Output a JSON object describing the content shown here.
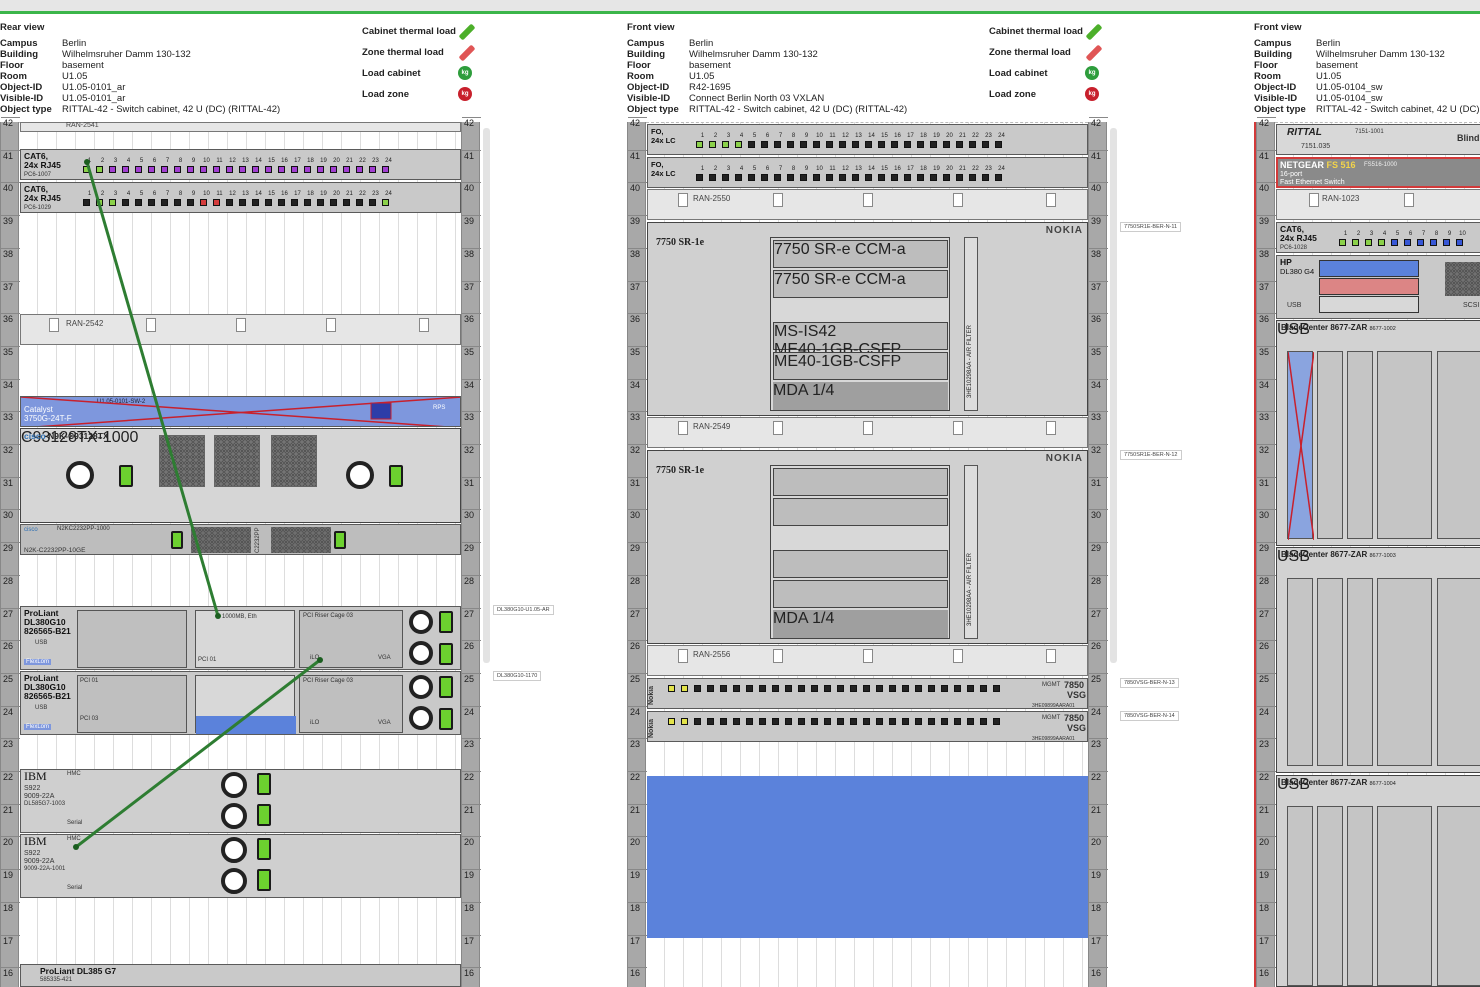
{
  "views": [
    {
      "view_title": "Rear view",
      "fields": [
        [
          "Campus",
          "Berlin"
        ],
        [
          "Building",
          "Wilhelmsruher Damm 130-132"
        ],
        [
          "Floor",
          "basement"
        ],
        [
          "Room",
          "U1.05"
        ],
        [
          "Object-ID",
          "U1.05-0101_ar"
        ],
        [
          "Visible-ID",
          "U1.05-0101_ar"
        ],
        [
          "Object type",
          "RITTAL-42 - Switch cabinet, 42 U (DC) (RITTAL-42)"
        ]
      ],
      "actions": [
        "Cabinet thermal load",
        "Zone thermal load",
        "Load cabinet",
        "Load zone"
      ]
    },
    {
      "view_title": "Front view",
      "fields": [
        [
          "Campus",
          "Berlin"
        ],
        [
          "Building",
          "Wilhelmsruher Damm 130-132"
        ],
        [
          "Floor",
          "basement"
        ],
        [
          "Room",
          "U1.05"
        ],
        [
          "Object-ID",
          "R42-1695"
        ],
        [
          "Visible-ID",
          "Connect Berlin North 03 VXLAN"
        ],
        [
          "Object type",
          "RITTAL-42 - Switch cabinet, 42 U (DC) (RITTAL-42)"
        ]
      ],
      "actions": [
        "Cabinet thermal load",
        "Zone thermal load",
        "Load cabinet",
        "Load zone"
      ]
    },
    {
      "view_title": "Front view",
      "fields": [
        [
          "Campus",
          "Berlin"
        ],
        [
          "Building",
          "Wilhelmsruher Damm 130-132"
        ],
        [
          "Floor",
          "basement"
        ],
        [
          "Room",
          "U1.05"
        ],
        [
          "Object-ID",
          "U1.05-0104_sw"
        ],
        [
          "Visible-ID",
          "U1.05-0104_sw"
        ],
        [
          "Object type",
          "RITTAL-42 - Switch cabinet, 42 U (DC)"
        ]
      ],
      "actions": []
    }
  ],
  "colors": {
    "accent_green": "#3bb54a",
    "pen_green": "#4caf2a",
    "pen_red": "#e05555",
    "load_green": "#2e9d3c",
    "load_red": "#c8202c",
    "unit_blue": "#5b82db",
    "cross": "#c8202c"
  },
  "units": [
    "42",
    "41",
    "40",
    "39",
    "38",
    "37",
    "36",
    "35",
    "34",
    "33",
    "32",
    "31",
    "30",
    "29",
    "28",
    "27",
    "26",
    "25",
    "24",
    "23",
    "22",
    "21",
    "20",
    "19",
    "18",
    "17",
    "16"
  ],
  "rack1": {
    "top_label": "RAN-2541",
    "patch1": {
      "name": "CAT6,",
      "name2": "24x RJ45",
      "id": "PC6-1007"
    },
    "patch2": {
      "name": "CAT6,",
      "name2": "24x RJ45",
      "id": "PC6-1029"
    },
    "ran2542": "RAN-2542",
    "catalyst": {
      "name": "Catalyst",
      "model": "3750G-24T-F",
      "id": "U1.05-0101-SW-2",
      "rps": "RPS"
    },
    "n9k": {
      "brand": "cisco",
      "name": "N9K-C93128TX",
      "id": "C93128TX-1000"
    },
    "n2k": {
      "name": "N2K-C2232PP-10GE",
      "id": "N2KC2232PP-1000",
      "tag": "C2232PP"
    },
    "proliant1": {
      "name": "ProLiant",
      "model": "DL380G10",
      "serial": "826565-B21",
      "usb": "USB",
      "flex": "FlexLom",
      "hp": "HP",
      "eth": "1000MB, Eth",
      "riser": "PCI Riser Cage 03",
      "ilo": "iLO",
      "vga": "VGA",
      "pci": "PCI 01"
    },
    "proliant2": {
      "name": "ProLiant",
      "model": "DL380G10",
      "serial": "826565-B21",
      "usb": "USB",
      "flex": "FlexLom",
      "riser": "PCI Riser Cage 03",
      "ilo": "iLO",
      "vga": "VGA",
      "pci1": "PCI 01",
      "pci2": "PCI 03"
    },
    "ibm1": {
      "name": "IBM",
      "model": "S922",
      "type": "9009-22A",
      "id": "DL585G7-1003",
      "hmc": "HMC",
      "serial": "Serial"
    },
    "ibm2": {
      "name": "IBM",
      "model": "S922",
      "type": "9009-22A",
      "id": "9009-22A-1001",
      "hmc": "HMC",
      "serial": "Serial"
    },
    "proliant3": {
      "name": "ProLiant DL385 G7",
      "id": "585335-421"
    },
    "ext_labels": [
      "DL380G10-U1.05-AR",
      "DL380G10-1170"
    ]
  },
  "rack2": {
    "patch1": {
      "name": "FO,",
      "name2": "24x LC"
    },
    "patch2": {
      "name": "FO,",
      "name2": "24x LC"
    },
    "ran2550": "RAN-2550",
    "nokia1": {
      "model": "7750 SR-1e",
      "brand": "NOKIA",
      "airfilter": "3HE10298AA - AIR FILTER",
      "mda": "MDA 1/4",
      "cards": [
        "7750 SR-e CCM-a",
        "7750 SR-e CCM-a",
        "MS-IS42",
        "ME40-1GB-CSFP",
        "ME40-1GB-CSFP"
      ]
    },
    "ran2549": "RAN-2549",
    "nokia2": {
      "model": "7750 SR-1e",
      "brand": "NOKIA",
      "airfilter": "3HE10298AA - AIR FILTER",
      "mda": "MDA 1/4"
    },
    "ran2556": "RAN-2556",
    "vsg1": {
      "brand": "Nokia",
      "model": "7850",
      "model2": "VSG",
      "mgmt": "MGMT",
      "part": "3HE09899AARA01"
    },
    "vsg2": {
      "brand": "Nokia",
      "model": "7850",
      "model2": "VSG",
      "mgmt": "MGMT",
      "part": "3HE09899AARA01"
    },
    "ext_labels": [
      "7750SR1E-BER-N-11",
      "7750SR1E-BER-N-12",
      "7850VSG-BER-N-13",
      "7850VSG-BER-N-14"
    ]
  },
  "rack3": {
    "rittal": {
      "brand": "RITTAL",
      "id": "7151.035",
      "part": "7151-1001",
      "blind": "Blind"
    },
    "netgear": {
      "brand": "NETGEAR",
      "model": "FS 516",
      "part": "FS516-1000",
      "desc1": "16-port",
      "desc2": "Fast Ethernet Switch"
    },
    "ran1023": "RAN-1023",
    "patch": {
      "name": "CAT6,",
      "name2": "24x RJ45",
      "id": "PC6-1028"
    },
    "hp": {
      "name": "HP",
      "model": "DL380 G4",
      "usb": "USB",
      "scsi": "SCSI"
    },
    "bc1": {
      "name": "BladeCenter 8677-ZAR",
      "id": "8677-1002",
      "usb": "USB"
    },
    "bc2": {
      "name": "BladeCenter 8677-ZAR",
      "id": "8677-1003",
      "usb": "USB"
    },
    "bc3": {
      "name": "BladeCenter 8677-ZAR",
      "id": "8677-1004",
      "usb": "USB"
    }
  }
}
